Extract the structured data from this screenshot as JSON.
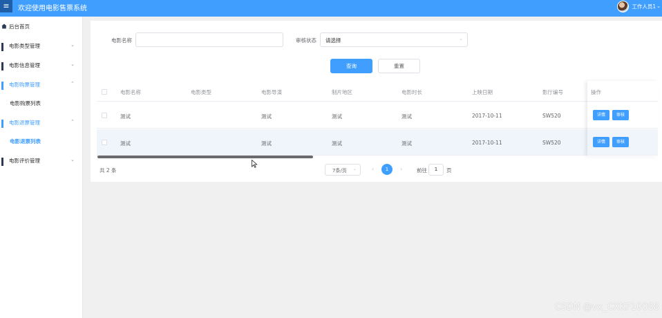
{
  "header": {
    "menu_icon": "hamburger-icon",
    "title": "欢迎使用电影售票系统",
    "user_name": "工作人员1",
    "user_caret": "v"
  },
  "sidebar": {
    "items": [
      {
        "label": "后台首页",
        "icon": "home-icon"
      },
      {
        "label": "电影类型管理",
        "icon": "grid-icon",
        "chevron": "v"
      },
      {
        "label": "电影信息管理",
        "icon": "grid-icon",
        "chevron": "v"
      },
      {
        "label": "电影购票管理",
        "icon": "grid-icon",
        "chevron": "^",
        "sub": "电影购票列表"
      },
      {
        "label": "电影退票管理",
        "icon": "grid-icon",
        "chevron": "^",
        "sub": "电影退票列表"
      },
      {
        "label": "电影评价管理",
        "icon": "grid-icon",
        "chevron": "v"
      }
    ]
  },
  "search": {
    "name_label": "电影名称",
    "name_value": "",
    "status_label": "审核状态",
    "status_placeholder": "请选择",
    "query_button": "查询",
    "reset_button": "重置"
  },
  "table": {
    "columns": [
      "电影名称",
      "电影类型",
      "电影导演",
      "制片地区",
      "电影时长",
      "上映日期",
      "影厅编号",
      "操作"
    ],
    "rows": [
      {
        "name": "测试",
        "type": "",
        "director": "测试",
        "region": "测试",
        "duration": "测试",
        "date": "2017-10-11",
        "hall": "SW520"
      },
      {
        "name": "测试",
        "type": "",
        "director": "测试",
        "region": "测试",
        "duration": "测试",
        "date": "2017-10-11",
        "hall": "SW520"
      }
    ],
    "detail_button": "详情",
    "audit_button": "审核"
  },
  "pagination": {
    "total": "共 2 条",
    "page_size": "7条/页",
    "current_page": "1",
    "goto_label": "前往",
    "goto_value": "1",
    "page_suffix": "页",
    "prev": "‹",
    "next": "›"
  },
  "watermark": "CSDN @vx_CXKF10088",
  "colors": {
    "primary": "#409eff",
    "header": "#409eff",
    "stripe": "#f0f5fb"
  }
}
